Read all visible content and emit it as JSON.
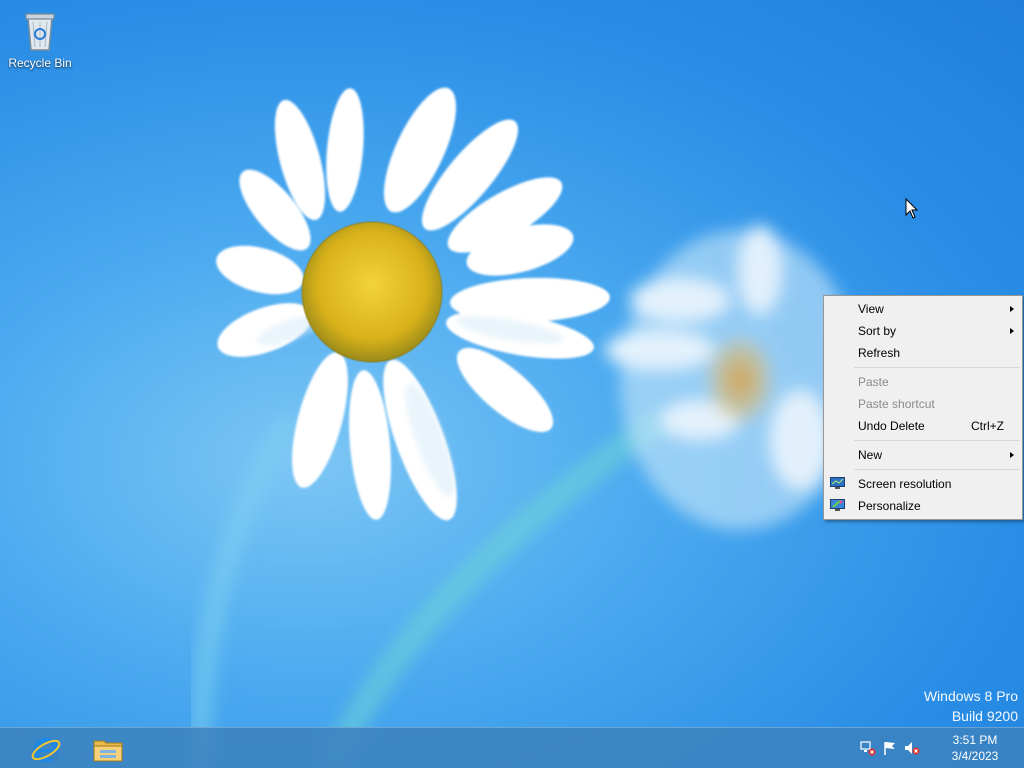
{
  "desktop": {
    "icons": [
      {
        "label": "Recycle Bin"
      }
    ],
    "watermark": {
      "line1": "Windows 8 Pro",
      "line2": "Build 9200"
    }
  },
  "context_menu": {
    "items": [
      {
        "label": "View",
        "submenu": true
      },
      {
        "label": "Sort by",
        "submenu": true
      },
      {
        "label": "Refresh"
      },
      {
        "label": "Paste",
        "disabled": true
      },
      {
        "label": "Paste shortcut",
        "disabled": true
      },
      {
        "label": "Undo Delete",
        "shortcut": "Ctrl+Z"
      },
      {
        "label": "New",
        "submenu": true
      },
      {
        "label": "Screen resolution",
        "icon": "monitor-icon"
      },
      {
        "label": "Personalize",
        "icon": "personalize-icon"
      }
    ]
  },
  "taskbar": {
    "pinned": [
      {
        "name": "Internet Explorer",
        "icon": "internet-explorer-icon"
      },
      {
        "name": "File Explorer",
        "icon": "file-explorer-icon"
      }
    ],
    "tray": {
      "icons": [
        "network-disconnected-icon",
        "action-center-flag-icon",
        "volume-muted-icon"
      ],
      "time": "3:51 PM",
      "date": "3/4/2023"
    }
  },
  "colors": {
    "desktop_bg": "#2a8ee6",
    "taskbar_bg": "#3c82be",
    "menu_bg": "#f0f0f0"
  }
}
